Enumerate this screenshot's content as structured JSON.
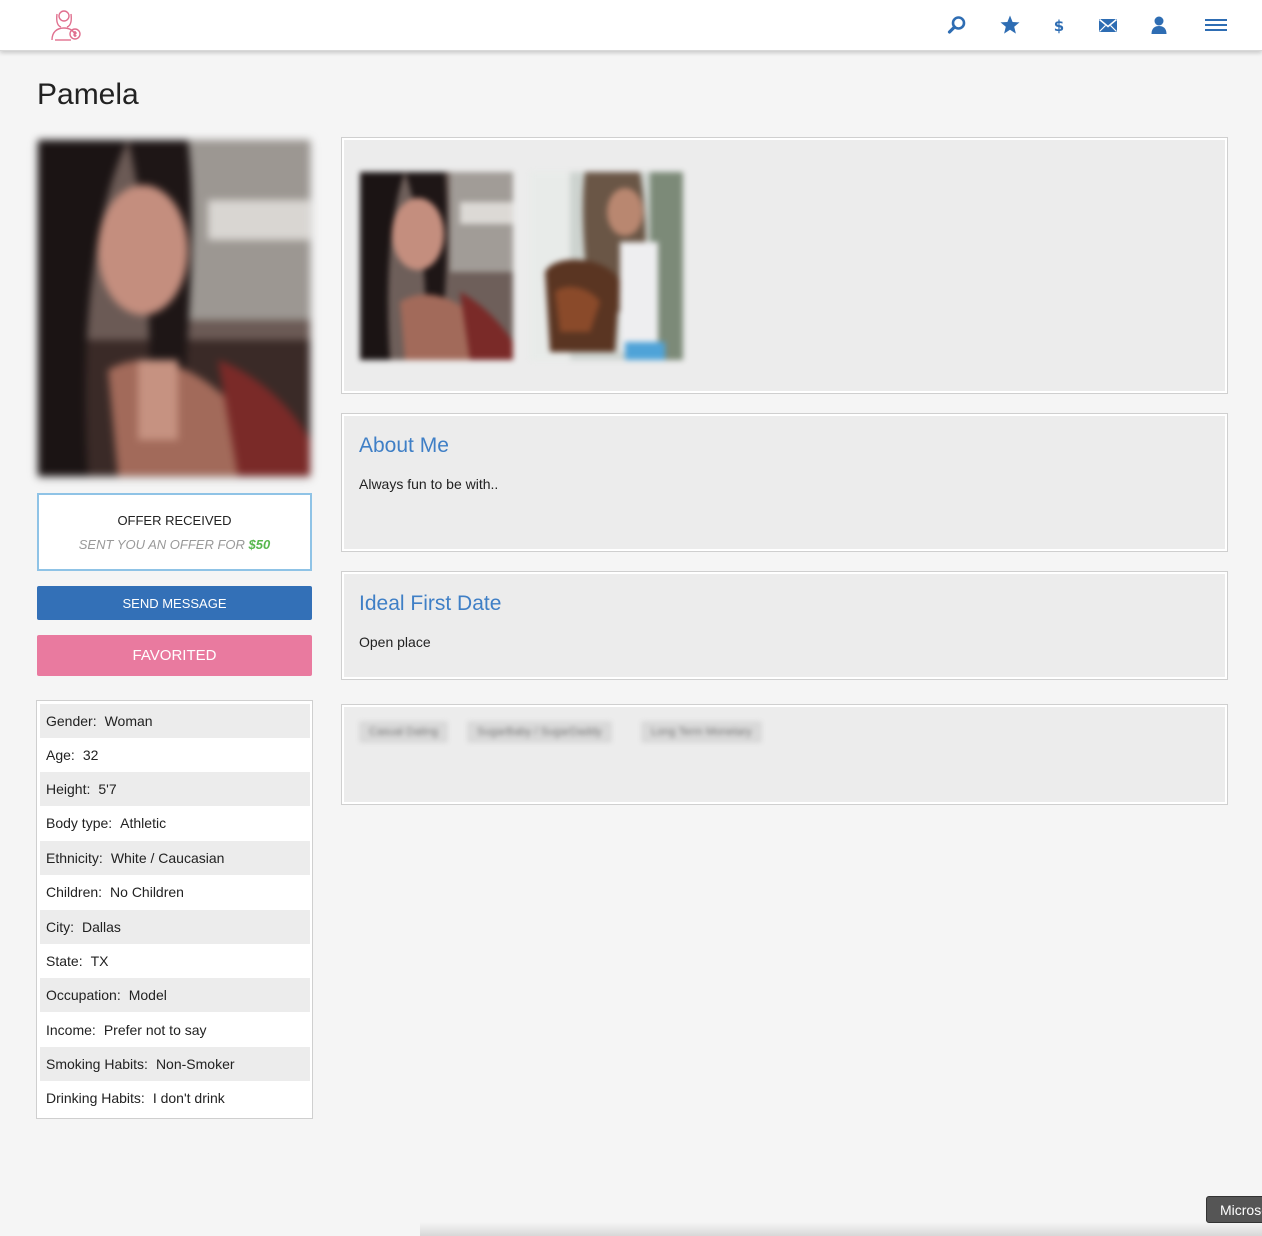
{
  "nav": {
    "icons": [
      "search-icon",
      "star-icon",
      "dollar-icon",
      "envelope-icon",
      "user-icon",
      "menu-icon"
    ]
  },
  "profile": {
    "name": "Pamela"
  },
  "offer": {
    "title": "OFFER RECEIVED",
    "text": "SENT YOU AN OFFER FOR",
    "amount": "$50"
  },
  "buttons": {
    "send_message": "SEND MESSAGE",
    "favorited": "FAVORITED"
  },
  "details": [
    {
      "label": "Gender:",
      "value": "Woman"
    },
    {
      "label": "Age:",
      "value": "32"
    },
    {
      "label": "Height:",
      "value": "5'7"
    },
    {
      "label": "Body type:",
      "value": "Athletic"
    },
    {
      "label": "Ethnicity:",
      "value": "White / Caucasian"
    },
    {
      "label": "Children:",
      "value": "No Children"
    },
    {
      "label": "City:",
      "value": "Dallas"
    },
    {
      "label": "State:",
      "value": "TX"
    },
    {
      "label": "Occupation:",
      "value": "Model"
    },
    {
      "label": "Income:",
      "value": "Prefer not to say"
    },
    {
      "label": "Smoking Habits:",
      "value": "Non-Smoker"
    },
    {
      "label": "Drinking Habits:",
      "value": "I don't drink"
    }
  ],
  "about": {
    "heading": "About Me",
    "text": "Always fun to be with.."
  },
  "first_date": {
    "heading": "Ideal First Date",
    "text": "Open place"
  },
  "tags": [
    "Casual Dating",
    "SugarBaby / SugarDaddy",
    "Long Term Monetary"
  ],
  "taskbar": {
    "label": "Microsoft"
  },
  "colors": {
    "accent_blue": "#3370b7",
    "heading_blue": "#3f7fc6",
    "pink": "#e97a9f",
    "offer_green": "#57b74d",
    "offer_border": "#8fc3e6"
  }
}
